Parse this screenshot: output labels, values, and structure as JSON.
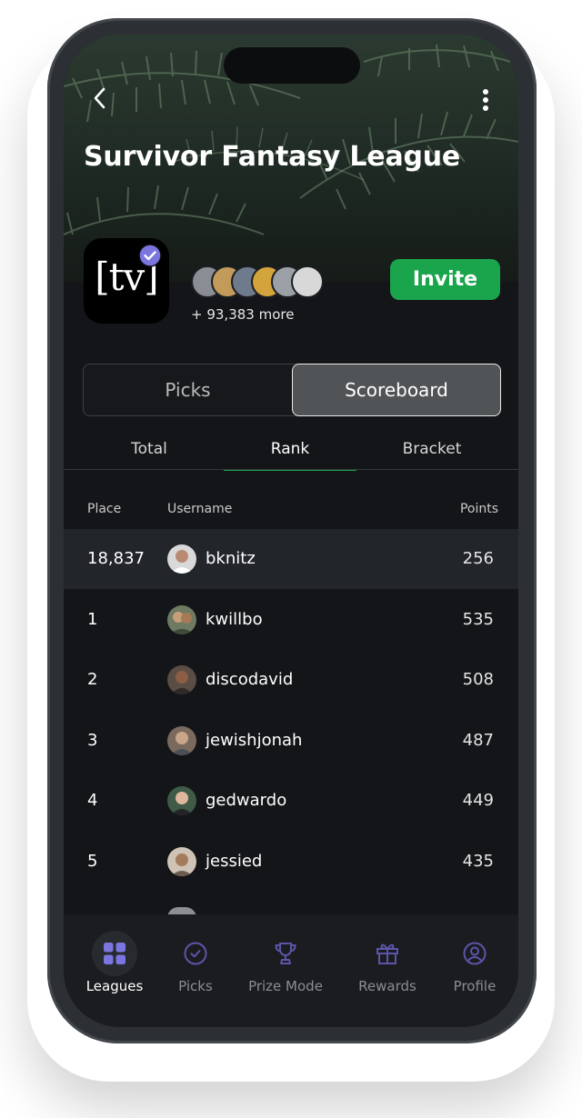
{
  "league": {
    "title": "Survivor Fantasy League",
    "logo_text": "[tv]",
    "members_more": "+ 93,383 more",
    "invite_label": "Invite"
  },
  "icons": {
    "back": "chevron-left-icon",
    "menu": "more-vertical-icon",
    "verified": "verified-badge-icon"
  },
  "segments": {
    "picks": "Picks",
    "scoreboard": "Scoreboard",
    "active": "scoreboard"
  },
  "subtabs": {
    "total": "Total",
    "rank": "Rank",
    "bracket": "Bracket",
    "active": "rank"
  },
  "table": {
    "headers": {
      "place": "Place",
      "username": "Username",
      "points": "Points"
    },
    "current_user": {
      "place": "18,837",
      "username": "bknitz",
      "points": "256"
    },
    "rows": [
      {
        "place": "1",
        "username": "kwillbo",
        "points": "535"
      },
      {
        "place": "2",
        "username": "discodavid",
        "points": "508"
      },
      {
        "place": "3",
        "username": "jewishjonah",
        "points": "487"
      },
      {
        "place": "4",
        "username": "gedwardo",
        "points": "449"
      },
      {
        "place": "5",
        "username": "jessied",
        "points": "435"
      }
    ]
  },
  "nav": {
    "items": [
      {
        "label": "Leagues",
        "icon": "grid-icon",
        "active": true
      },
      {
        "label": "Picks",
        "icon": "check-circle-icon",
        "active": false
      },
      {
        "label": "Prize Mode",
        "icon": "trophy-icon",
        "active": false
      },
      {
        "label": "Rewards",
        "icon": "gift-icon",
        "active": false
      },
      {
        "label": "Profile",
        "icon": "user-circle-icon",
        "active": false
      }
    ]
  },
  "colors": {
    "accent_green": "#1aa54c",
    "nav_active_purple": "#7b75e0",
    "nav_inactive_purple": "#5a55a8",
    "background": "#141518"
  }
}
